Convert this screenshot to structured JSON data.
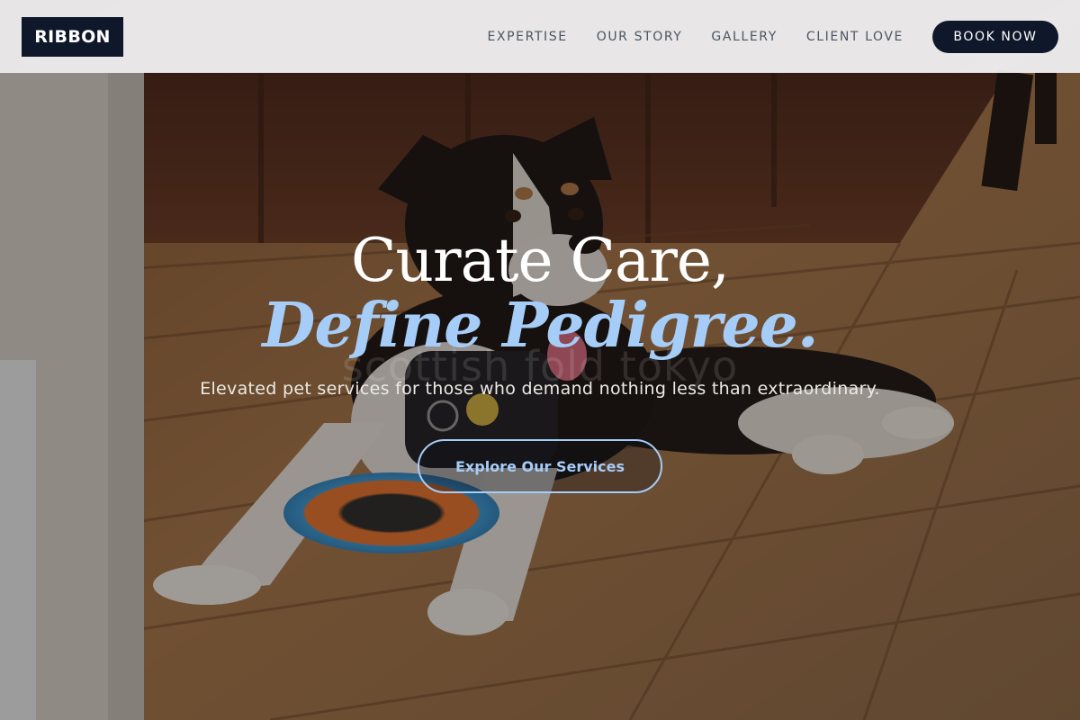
{
  "brand": {
    "logo_text": "RIBBON"
  },
  "nav": {
    "links": [
      "EXPERTISE",
      "OUR STORY",
      "GALLERY",
      "CLIENT LOVE"
    ],
    "book_label": "BOOK NOW"
  },
  "hero": {
    "headline_line1": "Curate Care,",
    "headline_line2": "Define Pedigree.",
    "watermark": "scottish fold tokyo",
    "subtitle": "Elevated pet services for those who demand nothing less than extraordinary.",
    "cta_label": "Explore Our Services"
  },
  "colors": {
    "brand_dark": "#0f172a",
    "accent_blue": "#a6ccf8",
    "header_bg": "#f0f0f2",
    "nav_text": "#4b5563"
  },
  "background_image": "dog-on-wooden-deck-photo"
}
